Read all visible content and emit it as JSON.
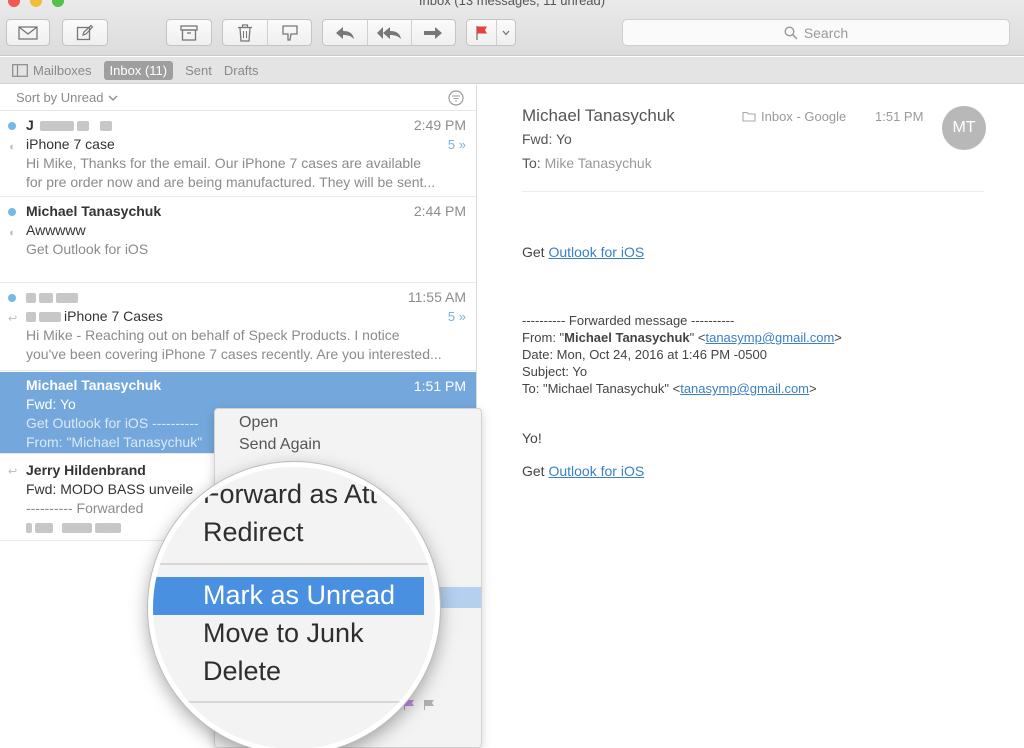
{
  "window": {
    "title": "Inbox (13 messages, 11 unread)"
  },
  "toolbar": {
    "icons": [
      "envelope-icon",
      "compose-icon",
      "archive-icon",
      "trash-icon",
      "junk-icon",
      "reply-icon",
      "reply-all-icon",
      "forward-icon",
      "flag-icon",
      "chevron-down-icon"
    ],
    "search_placeholder": "Search",
    "flag_color": "#e8413a"
  },
  "favorites": {
    "mailboxes": "Mailboxes",
    "inbox": "Inbox (11)",
    "sent": "Sent",
    "drafts": "Drafts"
  },
  "list": {
    "sort_label": "Sort by Unread",
    "messages": [
      {
        "from": "J",
        "time": "2:49 PM",
        "subject": "iPhone 7 case",
        "preview1": "Hi Mike,  Thanks for the email. Our iPhone 7 cases are available",
        "preview2": "for pre order now and are being manufactured. They will be sent...",
        "count": "5 »",
        "unread": true
      },
      {
        "from": "Michael Tanasychuk",
        "time": "2:44 PM",
        "subject": "Awwwww",
        "preview1": "Get Outlook for iOS",
        "unread": true
      },
      {
        "time": "11:55 AM",
        "subject": "iPhone 7 Cases",
        "preview1": "Hi Mike - Reaching out on behalf of Speck Products. I notice",
        "preview2": "you've been covering iPhone 7 cases recently. Are you interested...",
        "count": "5 »",
        "unread": true
      },
      {
        "from": "Michael Tanasychuk",
        "time": "1:51 PM",
        "subject": "Fwd: Yo",
        "preview1": "Get Outlook for iOS ----------",
        "preview2": "From: \"Michael Tanasychuk\"",
        "selected": true
      },
      {
        "from": "Jerry Hildenbrand",
        "subject": "Fwd: MODO BASS unveile",
        "preview1": "---------- Forwarded"
      }
    ]
  },
  "reader": {
    "from": "Michael Tanasychuk",
    "folder": "Inbox - Google",
    "time": "1:51 PM",
    "avatar_initials": "MT",
    "subject": "Fwd: Yo",
    "to_label": "To:",
    "to_name": "Mike Tanasychuk",
    "body": {
      "get_prefix": "Get ",
      "outlook_link": "Outlook for iOS",
      "fwd_header": "---------- Forwarded message ----------",
      "from_label": "From: \"",
      "from_name": "Michael Tanasychuk",
      "from_mid": "\" <",
      "email": "tanasymp@gmail.com",
      "close": ">",
      "date_line": "Date: Mon, Oct 24, 2016 at 1:46 PM -0500",
      "subject_line": "Subject: Yo",
      "to_line_prefix": "To: \"Michael Tanasychuk\" <",
      "yo": "Yo!"
    }
  },
  "context_menu": {
    "items": [
      "Open",
      "Send Again",
      "Forward as Att",
      "Redirect",
      "Mark as Unread",
      "Move to Junk",
      "Delete"
    ],
    "flag_colors": [
      "#7cc0ee",
      "#c58ee0",
      "#b0b0b0"
    ],
    "highlight_color": "#4a90e0"
  }
}
